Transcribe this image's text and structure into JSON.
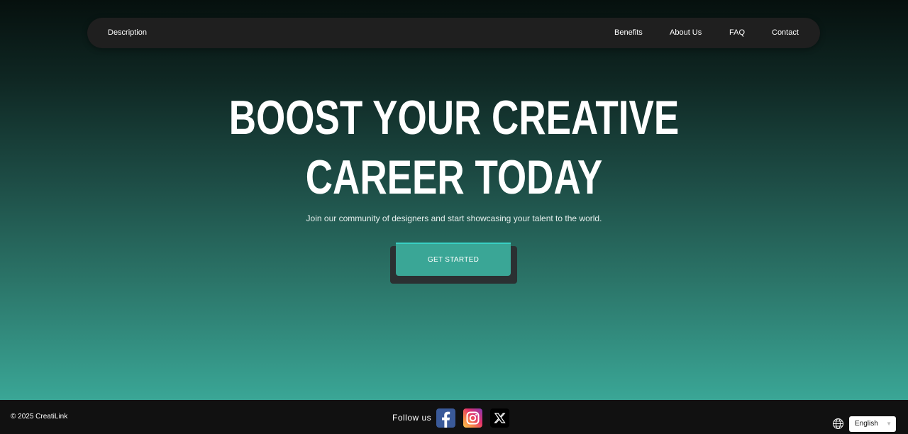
{
  "nav": {
    "description_label": "Description",
    "links": [
      {
        "label": "Benefits"
      },
      {
        "label": "About Us"
      },
      {
        "label": "FAQ"
      },
      {
        "label": "Contact"
      }
    ]
  },
  "hero": {
    "headline_line1": "BOOST YOUR CREATIVE",
    "headline_line2": "CAREER TODAY",
    "subtitle": "Join our community of designers and start showcasing your talent to the world.",
    "cta_label": "GET STARTED"
  },
  "footer": {
    "copyright": "© 2025 CreatiLink",
    "follow_label": "Follow us",
    "social": [
      {
        "icon": "facebook-icon"
      },
      {
        "icon": "instagram-icon"
      },
      {
        "icon": "x-icon"
      }
    ],
    "language": "English"
  },
  "colors": {
    "accent": "#3aa696",
    "nav_bg": "#1f1f1f",
    "footer_bg": "#111111"
  }
}
